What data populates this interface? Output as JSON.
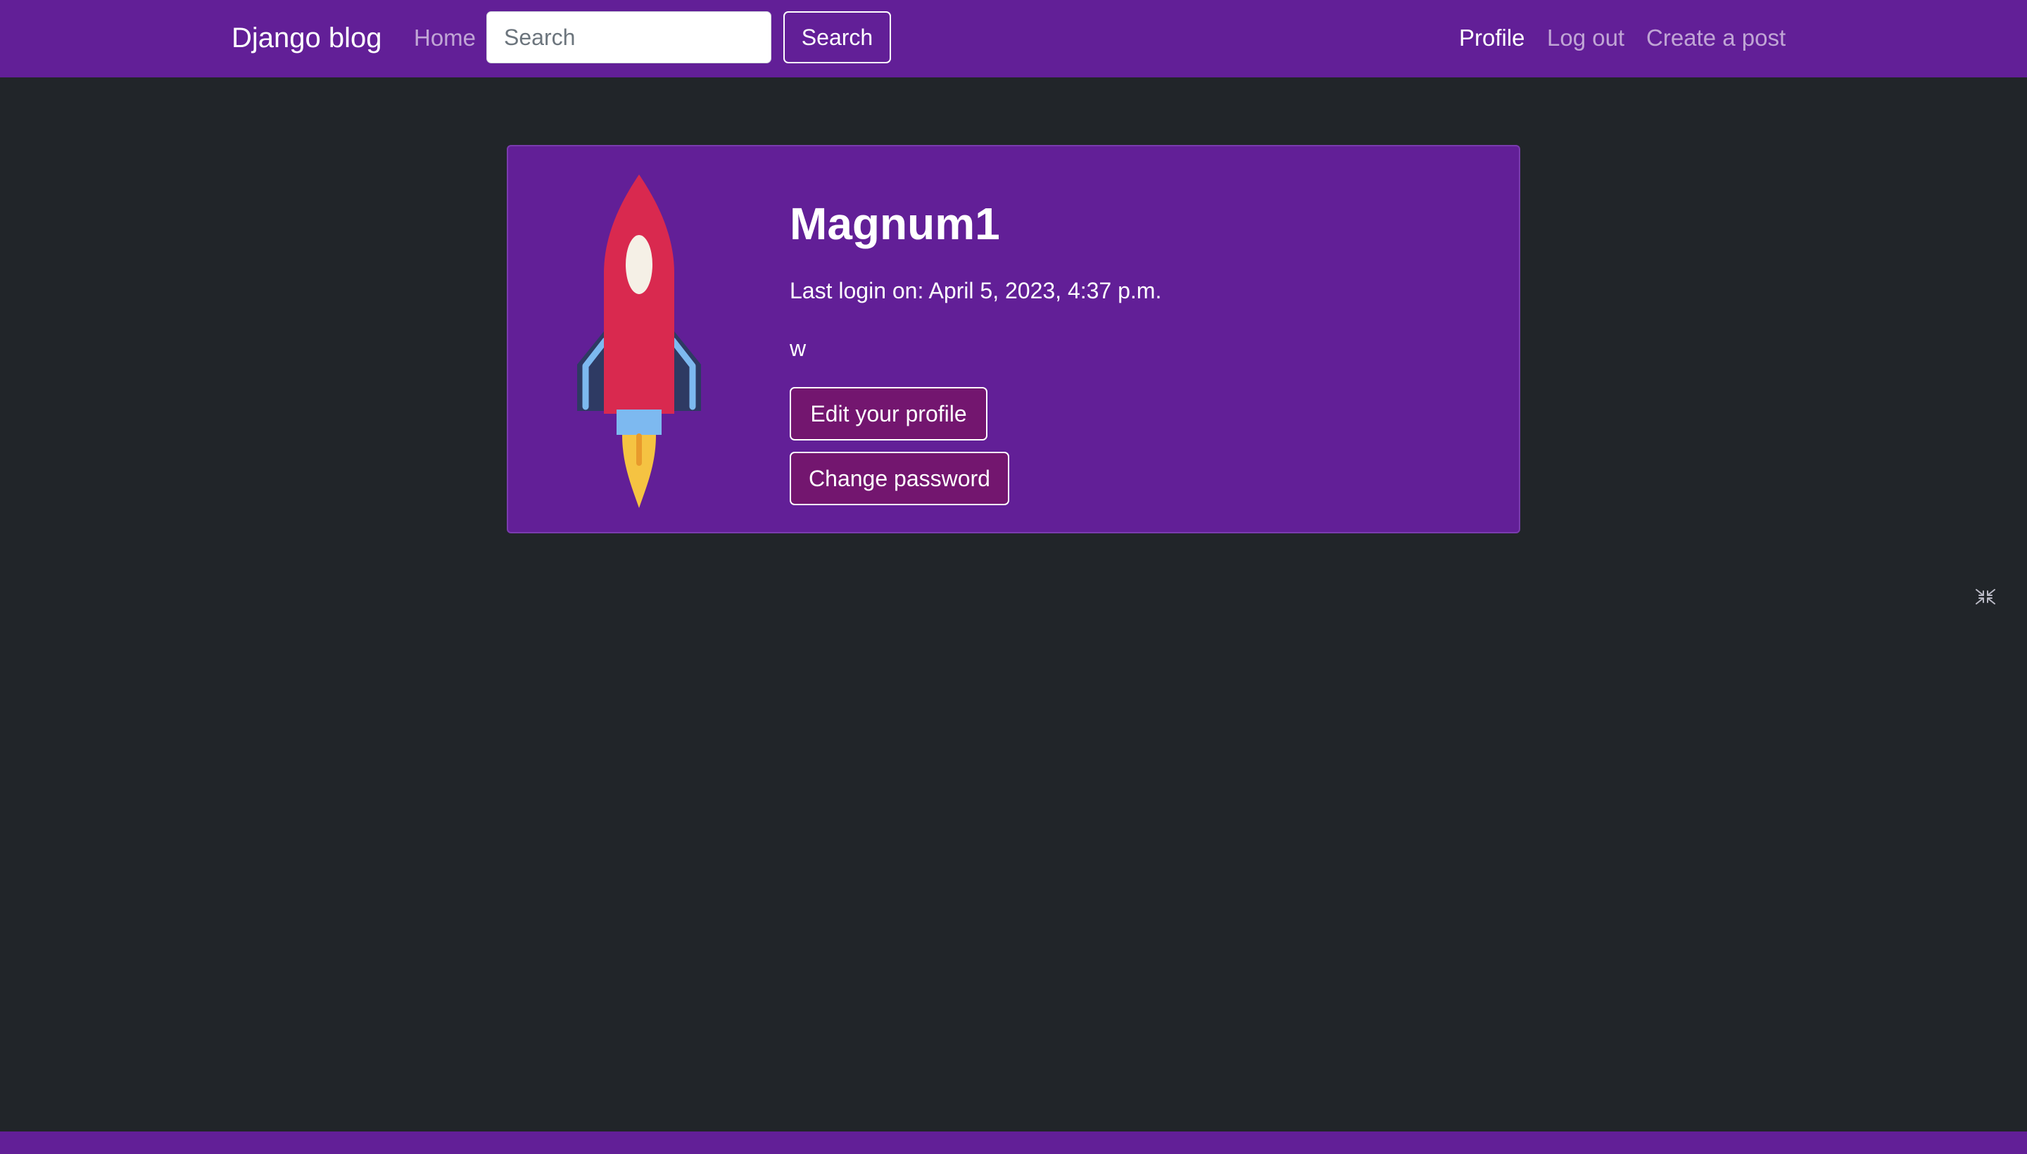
{
  "navbar": {
    "brand": "Django blog",
    "home_label": "Home",
    "search_placeholder": "Search",
    "search_button_label": "Search",
    "profile_label": "Profile",
    "logout_label": "Log out",
    "create_post_label": "Create a post"
  },
  "profile": {
    "username": "Magnum1",
    "last_login": "Last login on: April 5, 2023, 4:37 p.m.",
    "bio": "w",
    "edit_button_label": "Edit your profile",
    "change_password_label": "Change password",
    "avatar_icon": "rocket-icon"
  },
  "floating": {
    "icon": "collapse-arrows-icon"
  },
  "colors": {
    "navbar_bg": "#621f97",
    "page_bg": "#212529",
    "card_bg": "#621f97",
    "button_bg": "#73166f",
    "rocket_body": "#d9294f",
    "rocket_wings": "#2e3a63",
    "rocket_accent": "#7db9f0",
    "flame": "#f5c342"
  }
}
